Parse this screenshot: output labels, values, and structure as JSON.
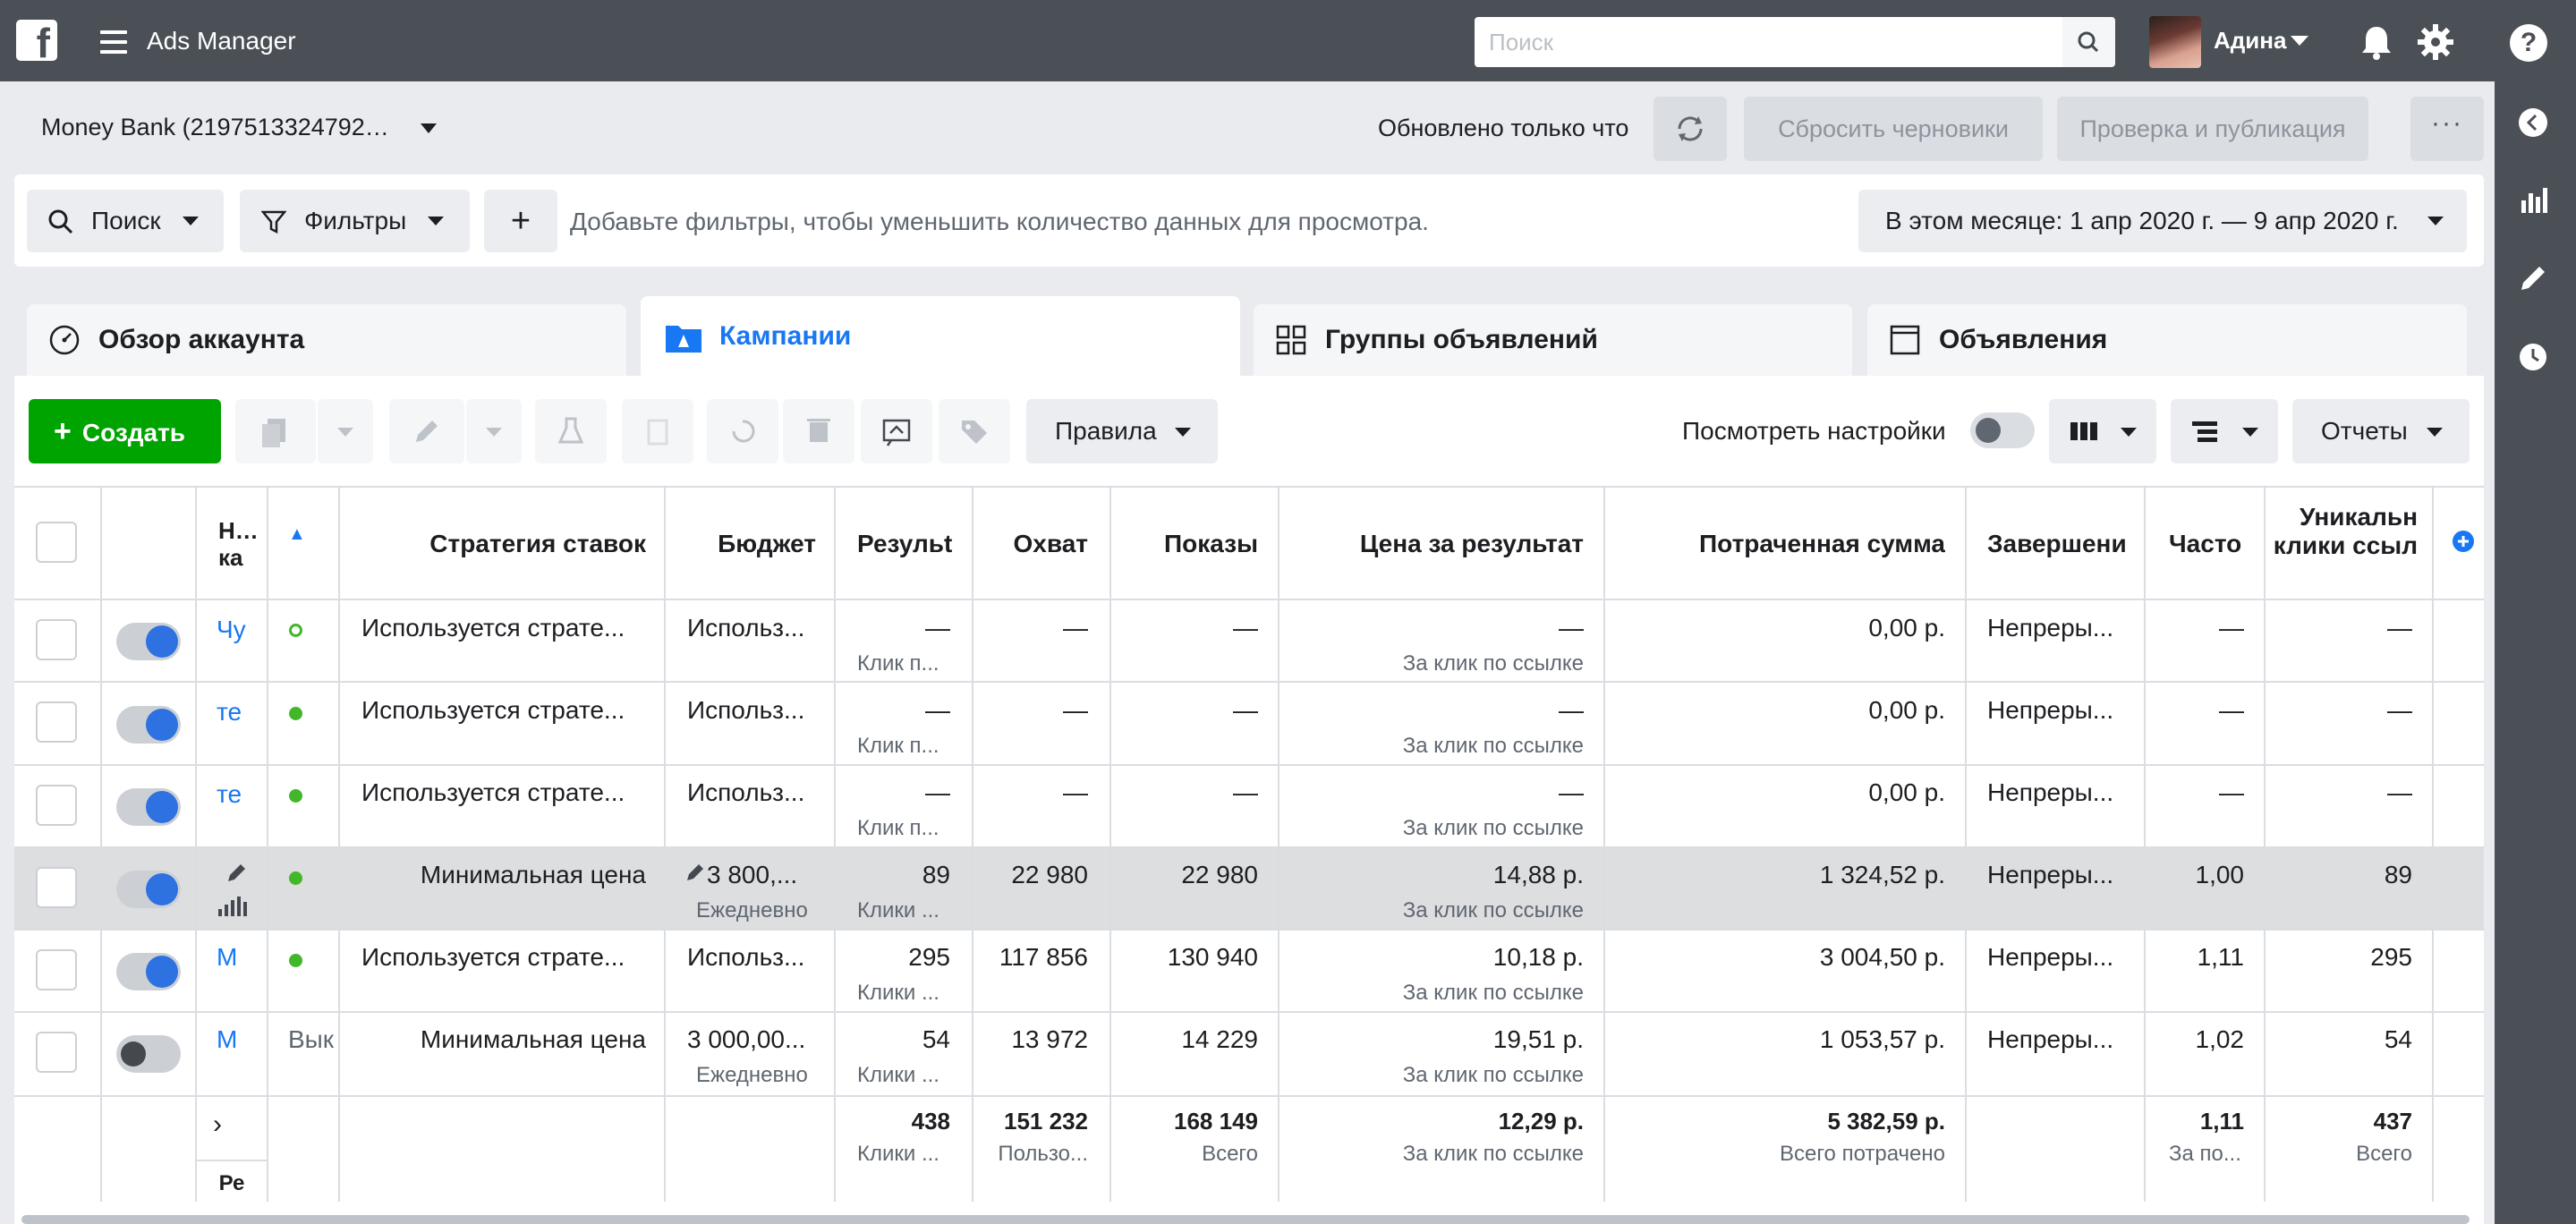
{
  "topbar": {
    "logo": "f",
    "app_title": "Ads Manager",
    "search_placeholder": "Поиск",
    "user_name": "Адина",
    "help": "?"
  },
  "account": {
    "name": "Money Bank (2197513324792…",
    "updated": "Обновлено только что",
    "discard_label": "Сбросить черновики",
    "publish_label": "Проверка и публикация",
    "more_label": "···"
  },
  "filters": {
    "search_label": "Поиск",
    "filters_label": "Фильтры",
    "add_label": "+",
    "hint": "Добавьте фильтры, чтобы уменьшить количество данных для просмотра.",
    "date_range": "В этом месяце: 1 апр 2020 г. — 9 апр 2020 г."
  },
  "tabs": {
    "overview": "Обзор аккаунта",
    "campaigns": "Кампании",
    "adsets": "Группы объявлений",
    "ads": "Объявления"
  },
  "toolbar": {
    "create_label": "Создать",
    "rules_label": "Правила",
    "view_settings_label": "Посмотреть настройки",
    "reports_label": "Отчеты"
  },
  "table": {
    "headers": {
      "name": "Н… ка",
      "strategy": "Стратегия ставок",
      "budget": "Бюджет",
      "results": "Резульt",
      "reach": "Охват",
      "impressions": "Показы",
      "cost_per_result": "Цена за результат",
      "spent": "Потраченная сумма",
      "ends": "Завершени",
      "frequency": "Часто",
      "unique_clicks": "Уникальн клики ссыл"
    },
    "rows": [
      {
        "name": "Чу",
        "status": "",
        "strategy": "Используется страте...",
        "budget": "Использ...",
        "results": "—",
        "results_sub": "Клик п...",
        "reach": "—",
        "impressions": "—",
        "cpr": "—",
        "cpr_sub": "За клик по ссылке",
        "spent": "0,00 р.",
        "ends": "Непреры...",
        "freq": "—",
        "unique": "—"
      },
      {
        "name": "те",
        "status": "",
        "strategy": "Используется страте...",
        "budget": "Использ...",
        "results": "—",
        "results_sub": "Клик п...",
        "reach": "—",
        "impressions": "—",
        "cpr": "—",
        "cpr_sub": "За клик по ссылке",
        "spent": "0,00 р.",
        "ends": "Непреры...",
        "freq": "—",
        "unique": "—"
      },
      {
        "name": "те",
        "status": "",
        "strategy": "Используется страте...",
        "budget": "Использ...",
        "results": "—",
        "results_sub": "Клик п...",
        "reach": "—",
        "impressions": "—",
        "cpr": "—",
        "cpr_sub": "За клик по ссылке",
        "spent": "0,00 р.",
        "ends": "Непреры...",
        "freq": "—",
        "unique": "—"
      },
      {
        "name": "",
        "status": "",
        "strategy": "Минимальная цена",
        "budget": "3 800,...",
        "budget_sub": "Ежедневно",
        "results": "89",
        "results_sub": "Клики ...",
        "reach": "22 980",
        "impressions": "22 980",
        "cpr": "14,88 р.",
        "cpr_sub": "За клик по ссылке",
        "spent": "1 324,52 р.",
        "ends": "Непреры...",
        "freq": "1,00",
        "unique": "89"
      },
      {
        "name": "М",
        "status": "",
        "strategy": "Используется страте...",
        "budget": "Использ...",
        "results": "295",
        "results_sub": "Клики ...",
        "reach": "117 856",
        "impressions": "130 940",
        "cpr": "10,18 р.",
        "cpr_sub": "За клик по ссылке",
        "spent": "3 004,50 р.",
        "ends": "Непреры...",
        "freq": "1,11",
        "unique": "295"
      },
      {
        "name": "М",
        "status": "Вык",
        "strategy": "Минимальная цена",
        "budget": "3 000,00...",
        "budget_sub": "Ежедневно",
        "results": "54",
        "results_sub": "Клики ...",
        "reach": "13 972",
        "impressions": "14 229",
        "cpr": "19,51 р.",
        "cpr_sub": "За клик по ссылке",
        "spent": "1 053,57 р.",
        "ends": "Непреры...",
        "freq": "1,02",
        "unique": "54"
      }
    ],
    "totals": {
      "label": "Ре",
      "results": "438",
      "results_sub": "Клики ...",
      "reach": "151 232",
      "reach_sub": "Пользо...",
      "impressions": "168 149",
      "impressions_sub": "Всего",
      "cpr": "12,29 р.",
      "cpr_sub": "За клик по ссылке",
      "spent": "5 382,59 р.",
      "spent_sub": "Всего потрачено",
      "freq": "1,11",
      "freq_sub": "За по...",
      "unique": "437",
      "unique_sub": "Всего"
    }
  },
  "colors": {
    "accent": "#1877f2",
    "create": "#00a400",
    "topbar": "#4b4f56",
    "active_dot": "#42b72a"
  }
}
